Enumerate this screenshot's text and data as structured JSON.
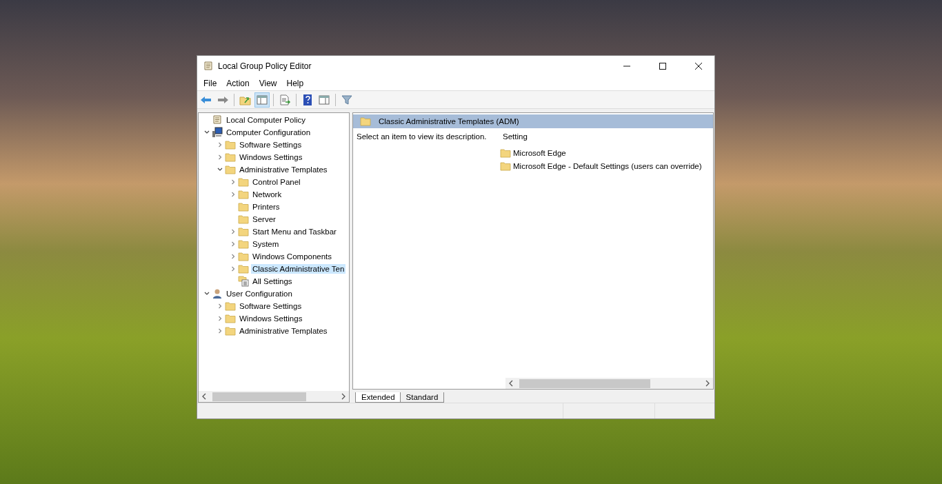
{
  "window": {
    "title": "Local Group Policy Editor"
  },
  "menu": [
    "File",
    "Action",
    "View",
    "Help"
  ],
  "toolbar": [
    {
      "kind": "back",
      "selected": false
    },
    {
      "kind": "forward",
      "selected": false
    },
    {
      "kind": "separator"
    },
    {
      "kind": "up",
      "selected": false
    },
    {
      "kind": "pane",
      "selected": true
    },
    {
      "kind": "separator"
    },
    {
      "kind": "export",
      "selected": false
    },
    {
      "kind": "separator"
    },
    {
      "kind": "help",
      "selected": false
    },
    {
      "kind": "properties",
      "selected": false
    },
    {
      "kind": "separator"
    },
    {
      "kind": "filter",
      "selected": false
    }
  ],
  "tree": [
    {
      "label": "Local Computer Policy",
      "kind": "policy",
      "selected": false,
      "children": [
        {
          "label": "Computer Configuration",
          "kind": "computer",
          "selected": false,
          "expanded": true,
          "children": [
            {
              "label": "Software Settings",
              "kind": "folder",
              "selected": false,
              "expanded": false
            },
            {
              "label": "Windows Settings",
              "kind": "folder",
              "selected": false,
              "expanded": false
            },
            {
              "label": "Administrative Templates",
              "kind": "folder",
              "selected": false,
              "expanded": true,
              "children": [
                {
                  "label": "Control Panel",
                  "kind": "folder",
                  "selected": false,
                  "expanded": false
                },
                {
                  "label": "Network",
                  "kind": "folder",
                  "selected": false,
                  "expanded": false
                },
                {
                  "label": "Printers",
                  "kind": "folder",
                  "selected": false
                },
                {
                  "label": "Server",
                  "kind": "folder",
                  "selected": false
                },
                {
                  "label": "Start Menu and Taskbar",
                  "kind": "folder",
                  "selected": false,
                  "expanded": false
                },
                {
                  "label": "System",
                  "kind": "folder",
                  "selected": false,
                  "expanded": false
                },
                {
                  "label": "Windows Components",
                  "kind": "folder",
                  "selected": false,
                  "expanded": false
                },
                {
                  "label": "Classic Administrative Ten",
                  "kind": "folder",
                  "selected": true,
                  "expanded": false
                },
                {
                  "label": "All Settings",
                  "kind": "settings",
                  "selected": false
                }
              ]
            }
          ]
        },
        {
          "label": "User Configuration",
          "kind": "user",
          "selected": false,
          "expanded": true,
          "children": [
            {
              "label": "Software Settings",
              "kind": "folder",
              "selected": false,
              "expanded": false
            },
            {
              "label": "Windows Settings",
              "kind": "folder",
              "selected": false,
              "expanded": false
            },
            {
              "label": "Administrative Templates",
              "kind": "folder",
              "selected": false,
              "expanded": false
            }
          ]
        }
      ]
    }
  ],
  "details": {
    "title": "Classic Administrative Templates (ADM)",
    "description": "Select an item to view its description.",
    "column": "Setting",
    "items": [
      {
        "label": "Microsoft Edge"
      },
      {
        "label": "Microsoft Edge - Default Settings (users can override)"
      }
    ]
  },
  "tabs": [
    {
      "label": "Extended",
      "selected": true
    },
    {
      "label": "Standard",
      "selected": false
    }
  ]
}
